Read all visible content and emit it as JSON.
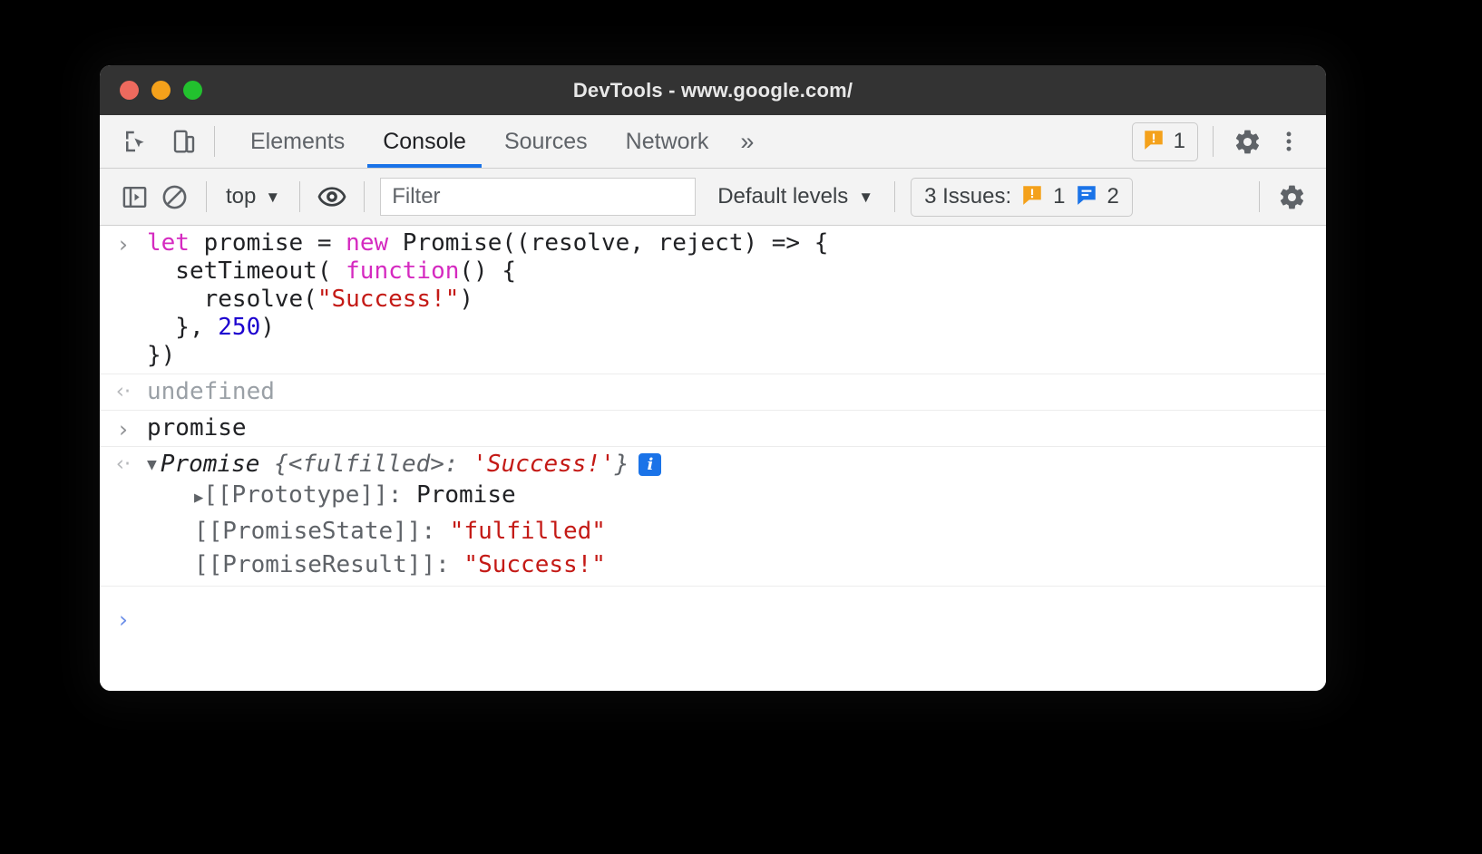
{
  "window": {
    "title": "DevTools - www.google.com/",
    "traffic_lights": [
      {
        "name": "close",
        "color": "#ED6A5E"
      },
      {
        "name": "minimize",
        "color": "#F4A11B"
      },
      {
        "name": "maximize",
        "color": "#22C12E"
      }
    ]
  },
  "tabbar": {
    "left_icons": [
      {
        "name": "inspect-element-icon",
        "label": "Inspect element"
      },
      {
        "name": "device-toolbar-icon",
        "label": "Toggle device toolbar"
      }
    ],
    "tabs": [
      {
        "label": "Elements",
        "active": false
      },
      {
        "label": "Console",
        "active": true
      },
      {
        "label": "Sources",
        "active": false
      },
      {
        "label": "Network",
        "active": false
      }
    ],
    "more_tabs": "»",
    "warning_badge": {
      "icon": "warning-message-icon",
      "count": "1",
      "color": "#F4A11B"
    },
    "settings_icon": "gear-icon",
    "menu_icon": "kebab-menu-icon"
  },
  "console_toolbar": {
    "sidebar_toggle_icon": "console-sidebar-icon",
    "clear_icon": "clear-console-icon",
    "context": {
      "label": "top",
      "caret": "▼"
    },
    "eye_icon": "live-expression-icon",
    "filter": {
      "placeholder": "Filter",
      "value": ""
    },
    "levels": {
      "label": "Default levels",
      "caret": "▼"
    },
    "issues": {
      "label": "3 Issues:",
      "warning_icon": "warning-message-icon",
      "warning_count": "1",
      "info_icon": "info-message-icon",
      "info_count": "2",
      "warning_color": "#F4A11B",
      "info_color": "#1a73e8"
    },
    "settings_icon": "gear-icon"
  },
  "console": {
    "entries": [
      {
        "type": "input",
        "gutter": "›",
        "lines": [
          [
            {
              "t": "let ",
              "c": "kw"
            },
            {
              "t": "promise = ",
              "c": ""
            },
            {
              "t": "new ",
              "c": "kw"
            },
            {
              "t": "Promise((resolve, reject) => {",
              "c": ""
            }
          ],
          [
            {
              "t": "  setTimeout( ",
              "c": ""
            },
            {
              "t": "function",
              "c": "kw"
            },
            {
              "t": "() {",
              "c": ""
            }
          ],
          [
            {
              "t": "    resolve(",
              "c": ""
            },
            {
              "t": "\"Success!\"",
              "c": "str"
            },
            {
              "t": ")",
              "c": ""
            }
          ],
          [
            {
              "t": "  }, ",
              "c": ""
            },
            {
              "t": "250",
              "c": "num"
            },
            {
              "t": ")",
              "c": ""
            }
          ],
          [
            {
              "t": "})",
              "c": ""
            }
          ]
        ]
      },
      {
        "type": "output",
        "gutter": "‹·",
        "text": "undefined"
      },
      {
        "type": "input",
        "gutter": "›",
        "lines": [
          [
            {
              "t": "promise",
              "c": ""
            }
          ]
        ]
      }
    ],
    "result": {
      "gutter": "‹·",
      "expand_triangle": "▼",
      "class_name": "Promise",
      "preview_open": " {",
      "state_key": "<fulfilled>",
      "colon": ": ",
      "value": "'Success!'",
      "preview_close": "}",
      "info_badge": "i",
      "properties": [
        {
          "triangle": "▶",
          "name": "[[Prototype]]",
          "separator": ": ",
          "value": "Promise",
          "value_kind": "plain"
        },
        {
          "triangle": "",
          "name": "[[PromiseState]]",
          "separator": ": ",
          "value": "\"fulfilled\"",
          "value_kind": "string"
        },
        {
          "triangle": "",
          "name": "[[PromiseResult]]",
          "separator": ": ",
          "value": "\"Success!\"",
          "value_kind": "string"
        }
      ]
    },
    "prompt": {
      "gutter": "›",
      "value": ""
    }
  }
}
